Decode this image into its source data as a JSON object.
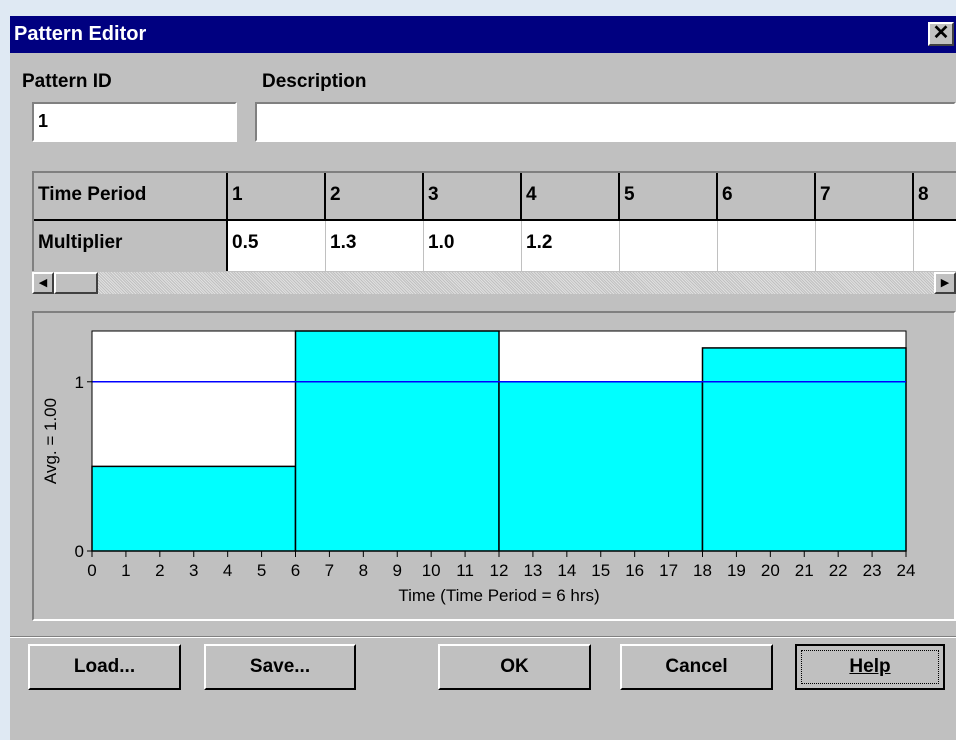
{
  "window": {
    "title": "Pattern Editor",
    "close_glyph": "✕"
  },
  "fields": {
    "pattern_id_label": "Pattern ID",
    "pattern_id_value": "1",
    "description_label": "Description",
    "description_value": ""
  },
  "grid": {
    "header_label": "Time Period",
    "row_label": "Multiplier",
    "periods": [
      "1",
      "2",
      "3",
      "4",
      "5",
      "6",
      "7",
      "8"
    ],
    "multipliers": [
      "0.5",
      "1.3",
      "1.0",
      "1.2",
      "",
      "",
      "",
      ""
    ]
  },
  "chart_data": {
    "type": "bar",
    "categories": [
      "0-6",
      "6-12",
      "12-18",
      "18-24"
    ],
    "values": [
      0.5,
      1.3,
      1.0,
      1.2
    ],
    "average": 1.0,
    "ylabel": "Avg. = 1.00",
    "xlabel": "Time (Time Period = 6 hrs)",
    "x_ticks": [
      "0",
      "1",
      "2",
      "3",
      "4",
      "5",
      "6",
      "7",
      "8",
      "9",
      "10",
      "11",
      "12",
      "13",
      "14",
      "15",
      "16",
      "17",
      "18",
      "19",
      "20",
      "21",
      "22",
      "23",
      "24"
    ],
    "y_ticks": [
      "0",
      "1"
    ],
    "xlim": [
      0,
      24
    ],
    "ylim": [
      0,
      1.3
    ],
    "bar_color": "#00ffff",
    "avg_line_color": "#0000ff"
  },
  "buttons": {
    "load": "Load...",
    "save": "Save...",
    "ok": "OK",
    "cancel": "Cancel",
    "help": "Help"
  },
  "colors": {
    "titlebar": "#000080",
    "face": "#c0c0c0"
  }
}
